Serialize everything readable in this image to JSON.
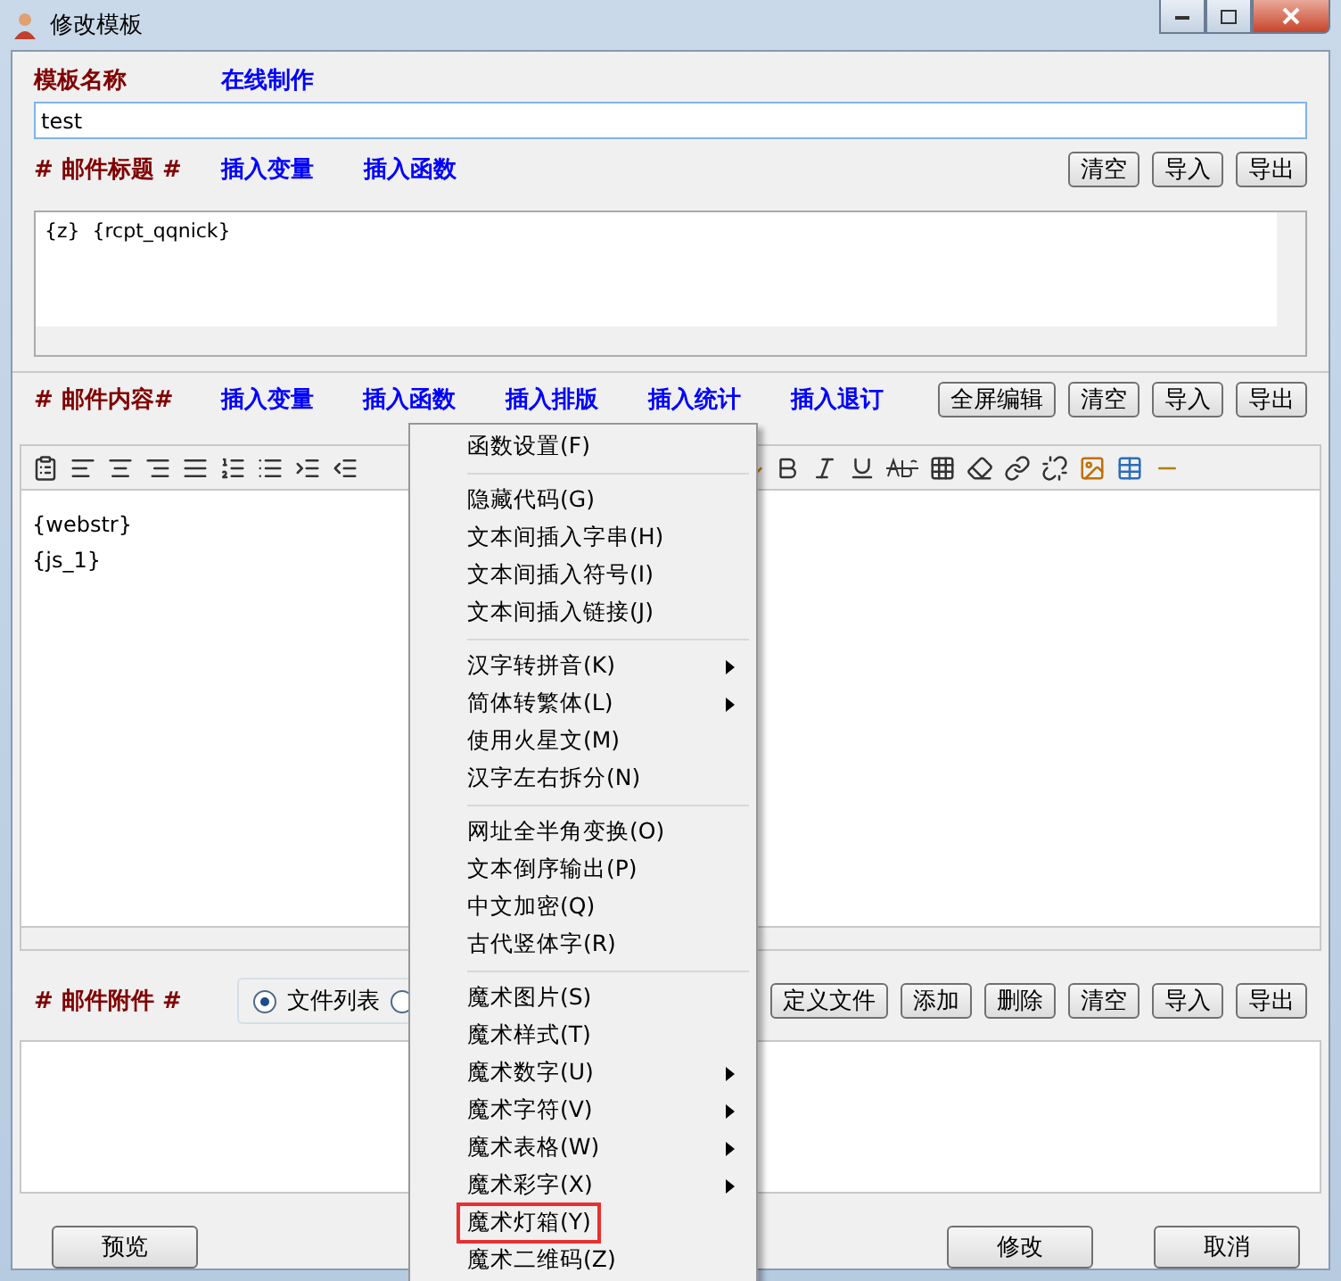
{
  "window": {
    "title": "修改模板"
  },
  "template_name": {
    "label": "模板名称",
    "link": "在线制作",
    "value": "test"
  },
  "subject": {
    "label": "# 邮件标题 #",
    "links": [
      "插入变量",
      "插入函数"
    ],
    "buttons": [
      "清空",
      "导入",
      "导出"
    ],
    "value": "{z}  {rcpt_qqnick}"
  },
  "body": {
    "label": "# 邮件内容#",
    "links": [
      "插入变量",
      "插入函数",
      "插入排版",
      "插入统计",
      "插入退订"
    ],
    "buttons": [
      "全屏编辑",
      "清空",
      "导入",
      "导出"
    ],
    "lines": [
      "{webstr}",
      "{js_1}"
    ]
  },
  "attachments": {
    "label": "# 邮件附件 #",
    "radios": [
      {
        "label": "文件列表",
        "selected": true
      },
      {
        "selected": false
      }
    ],
    "buttons": [
      "定义文件",
      "添加",
      "删除",
      "清空",
      "导入",
      "导出"
    ]
  },
  "footer": {
    "left_button": "预览",
    "right_buttons": [
      "修改",
      "取消"
    ]
  },
  "context_menu": {
    "groups": [
      [
        {
          "label": "函数设置(F)",
          "submenu": false,
          "marked": false
        }
      ],
      [
        {
          "label": "隐藏代码(G)",
          "submenu": false,
          "marked": false
        },
        {
          "label": "文本间插入字串(H)",
          "submenu": false,
          "marked": false
        },
        {
          "label": "文本间插入符号(I)",
          "submenu": false,
          "marked": false
        },
        {
          "label": "文本间插入链接(J)",
          "submenu": false,
          "marked": false
        }
      ],
      [
        {
          "label": "汉字转拼音(K)",
          "submenu": true,
          "marked": false
        },
        {
          "label": "简体转繁体(L)",
          "submenu": true,
          "marked": false
        },
        {
          "label": "使用火星文(M)",
          "submenu": false,
          "marked": false
        },
        {
          "label": "汉字左右拆分(N)",
          "submenu": false,
          "marked": false
        }
      ],
      [
        {
          "label": "网址全半角变换(O)",
          "submenu": false,
          "marked": false
        },
        {
          "label": "文本倒序输出(P)",
          "submenu": false,
          "marked": false
        },
        {
          "label": "中文加密(Q)",
          "submenu": false,
          "marked": false
        },
        {
          "label": "古代竖体字(R)",
          "submenu": false,
          "marked": false
        }
      ],
      [
        {
          "label": "魔术图片(S)",
          "submenu": false,
          "marked": false
        },
        {
          "label": "魔术样式(T)",
          "submenu": false,
          "marked": false
        },
        {
          "label": "魔术数字(U)",
          "submenu": true,
          "marked": false
        },
        {
          "label": "魔术字符(V)",
          "submenu": true,
          "marked": false
        },
        {
          "label": "魔术表格(W)",
          "submenu": true,
          "marked": false
        },
        {
          "label": "魔术彩字(X)",
          "submenu": true,
          "marked": false
        },
        {
          "label": "魔术灯箱(Y)",
          "submenu": false,
          "marked": true
        },
        {
          "label": "魔术二维码(Z)",
          "submenu": false,
          "marked": false
        }
      ]
    ]
  }
}
